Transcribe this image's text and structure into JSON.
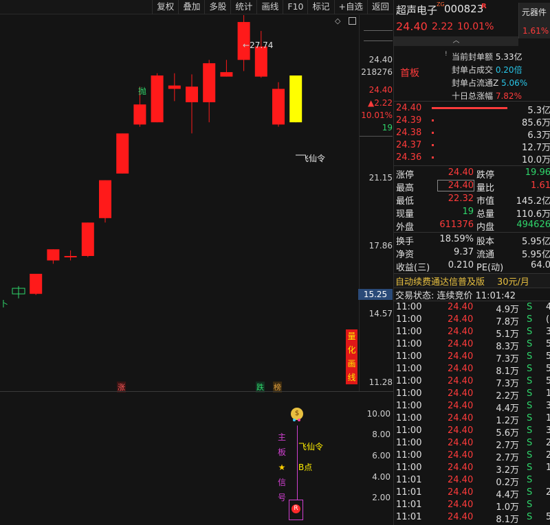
{
  "toolbar": {
    "buttons": [
      "复权",
      "叠加",
      "多股",
      "统计",
      "画线",
      "F10",
      "标记",
      "+自选",
      "返回"
    ]
  },
  "chart": {
    "high_label": "27.74",
    "price_axis": [
      "24.40",
      "21.15",
      "17.86",
      "14.57",
      "11.28"
    ],
    "axis_values": {
      "volume": "218276",
      "price": "24.40",
      "change": "▲2.22",
      "pct": "10.01%",
      "small": "19"
    },
    "crosshair_price": "15.25",
    "sell_mark": "抛",
    "feixianling": "飞仙令",
    "markers": {
      "zhang": "涨",
      "die": "跌",
      "bang": "榜"
    },
    "side_button_chars": [
      "量",
      "化",
      "画",
      "线"
    ],
    "lower_axis": [
      "10.00",
      "8.00",
      "6.00",
      "4.00",
      "2.00"
    ],
    "lower_labels": {
      "feixianling": "飞仙令",
      "bpoint": "B点",
      "vertical_chars": [
        "主",
        "板",
        "★",
        "信",
        "号"
      ]
    },
    "candles": [
      {
        "o": 14.6,
        "c": 14.85,
        "h": 14.95,
        "l": 14.4,
        "color": "green-hollow"
      },
      {
        "o": 14.6,
        "c": 15.5,
        "h": 15.5,
        "l": 14.55,
        "color": "red"
      },
      {
        "o": 16.1,
        "c": 16.6,
        "h": 16.6,
        "l": 15.95,
        "color": "red"
      },
      {
        "o": 16.3,
        "c": 16.3,
        "h": 16.55,
        "l": 16.1,
        "color": "red-cross"
      },
      {
        "o": 16.3,
        "c": 17.8,
        "h": 17.8,
        "l": 16.25,
        "color": "red"
      },
      {
        "o": 18.0,
        "c": 19.7,
        "h": 19.7,
        "l": 17.8,
        "color": "red"
      },
      {
        "o": 20.0,
        "c": 21.8,
        "h": 21.8,
        "l": 20.0,
        "color": "red"
      },
      {
        "o": 22.2,
        "c": 23.1,
        "h": 23.9,
        "l": 22.1,
        "color": "red"
      },
      {
        "o": 22.3,
        "c": 24.4,
        "h": 24.5,
        "l": 22.3,
        "color": "red"
      },
      {
        "o": 23.8,
        "c": 23.95,
        "h": 24.5,
        "l": 23.25,
        "color": "red-cross"
      },
      {
        "o": 23.2,
        "c": 23.9,
        "h": 24.45,
        "l": 21.8,
        "color": "red"
      },
      {
        "o": 23.2,
        "c": 24.95,
        "h": 25.1,
        "l": 22.3,
        "color": "red"
      },
      {
        "o": 24.35,
        "c": 24.55,
        "h": 25.1,
        "l": 24.35,
        "color": "red"
      },
      {
        "o": 25.1,
        "c": 26.8,
        "h": 27.74,
        "l": 24.6,
        "color": "red"
      },
      {
        "o": 24.35,
        "c": 25.7,
        "h": 26.4,
        "l": 24.3,
        "color": "red"
      },
      {
        "o": 22.2,
        "c": 23.8,
        "h": 24.1,
        "l": 22.1,
        "color": "red"
      },
      {
        "o": 22.3,
        "c": 24.4,
        "h": 24.4,
        "l": 22.3,
        "color": "yellow"
      }
    ]
  },
  "quote": {
    "name": "超声电子",
    "tag": "ZG",
    "code": "000823",
    "r_badge": "R",
    "sector": "元器件",
    "sector_pct": "1.61%",
    "price": "24.40",
    "change": "2.22",
    "pct": "10.01%",
    "board_label": "首板",
    "seal_rows": [
      {
        "label": "当前封单额",
        "value": "5.33亿"
      },
      {
        "label": "封单占成交",
        "value": "0.20倍"
      },
      {
        "label": "封单占流通Z",
        "value": "5.06%"
      },
      {
        "label": "十日总涨幅",
        "value": "7.82%"
      }
    ],
    "order_book": [
      {
        "price": "24.40",
        "vol": "5.3亿",
        "bar": 1.0
      },
      {
        "price": "24.39",
        "vol": "85.6万",
        "bar": 0.02
      },
      {
        "price": "24.38",
        "vol": "6.3万",
        "bar": 0.02
      },
      {
        "price": "24.37",
        "vol": "12.7万",
        "bar": 0.02
      },
      {
        "price": "24.36",
        "vol": "10.0万",
        "bar": 0.02
      }
    ],
    "stats": [
      {
        "l1": "涨停",
        "v1": "24.40",
        "l2": "跌停",
        "v2": "19.96",
        "c1": "red",
        "c2": "green"
      },
      {
        "l1": "最高",
        "v1": "24.40",
        "l2": "量比",
        "v2": "1.61",
        "c1": "red",
        "c2": "red"
      },
      {
        "l1": "最低",
        "v1": "22.32",
        "l2": "市值",
        "v2": "145.2亿",
        "c1": "red",
        "c2": "white"
      },
      {
        "l1": "现量",
        "v1": "19",
        "l2": "总量",
        "v2": "110.6万",
        "c1": "green",
        "c2": "white"
      },
      {
        "l1": "外盘",
        "v1": "611376",
        "l2": "内盘",
        "v2": "494626",
        "c1": "red",
        "c2": "green"
      }
    ],
    "stats2": [
      {
        "l1": "换手",
        "v1": "18.59%",
        "l2": "股本",
        "v2": "5.95亿"
      },
      {
        "l1": "净资",
        "v1": "9.37",
        "l2": "流通",
        "v2": "5.95亿"
      },
      {
        "l1": "收益(三)",
        "v1": "0.210",
        "l2": "PE(动)",
        "v2": "64.0"
      }
    ],
    "promo": "自动续费通达信普及版",
    "promo_price": "30元/月",
    "trade_state": "交易状态: 连续竞价 11:01:42",
    "ticks": [
      {
        "t": "11:00",
        "p": "24.40",
        "v": "4.9万",
        "s": "S",
        "n": "4"
      },
      {
        "t": "11:00",
        "p": "24.40",
        "v": "7.8万",
        "s": "S",
        "n": "("
      },
      {
        "t": "11:00",
        "p": "24.40",
        "v": "5.1万",
        "s": "S",
        "n": "3"
      },
      {
        "t": "11:00",
        "p": "24.40",
        "v": "8.3万",
        "s": "S",
        "n": "5"
      },
      {
        "t": "11:00",
        "p": "24.40",
        "v": "7.3万",
        "s": "S",
        "n": "5"
      },
      {
        "t": "11:00",
        "p": "24.40",
        "v": "8.1万",
        "s": "S",
        "n": "5"
      },
      {
        "t": "11:00",
        "p": "24.40",
        "v": "7.3万",
        "s": "S",
        "n": "5"
      },
      {
        "t": "11:00",
        "p": "24.40",
        "v": "2.2万",
        "s": "S",
        "n": "1"
      },
      {
        "t": "11:00",
        "p": "24.40",
        "v": "4.4万",
        "s": "S",
        "n": "3"
      },
      {
        "t": "11:00",
        "p": "24.40",
        "v": "1.2万",
        "s": "S",
        "n": "1"
      },
      {
        "t": "11:00",
        "p": "24.40",
        "v": "5.6万",
        "s": "S",
        "n": "3"
      },
      {
        "t": "11:00",
        "p": "24.40",
        "v": "2.7万",
        "s": "S",
        "n": "2"
      },
      {
        "t": "11:00",
        "p": "24.40",
        "v": "2.7万",
        "s": "S",
        "n": "2"
      },
      {
        "t": "11:00",
        "p": "24.40",
        "v": "3.2万",
        "s": "S",
        "n": "1"
      },
      {
        "t": "11:01",
        "p": "24.40",
        "v": "0.2万",
        "s": "S",
        "n": ""
      },
      {
        "t": "11:01",
        "p": "24.40",
        "v": "4.4万",
        "s": "S",
        "n": "2"
      },
      {
        "t": "11:01",
        "p": "24.40",
        "v": "1.0万",
        "s": "S",
        "n": ""
      },
      {
        "t": "11:01",
        "p": "24.40",
        "v": "8.1万",
        "s": "S",
        "n": "5"
      }
    ]
  },
  "colors": {
    "red": "#ff2a2a",
    "green": "#2fd66b",
    "yellow": "#ffff00",
    "magenta": "#d040d0",
    "cyan": "#28c6e8"
  }
}
